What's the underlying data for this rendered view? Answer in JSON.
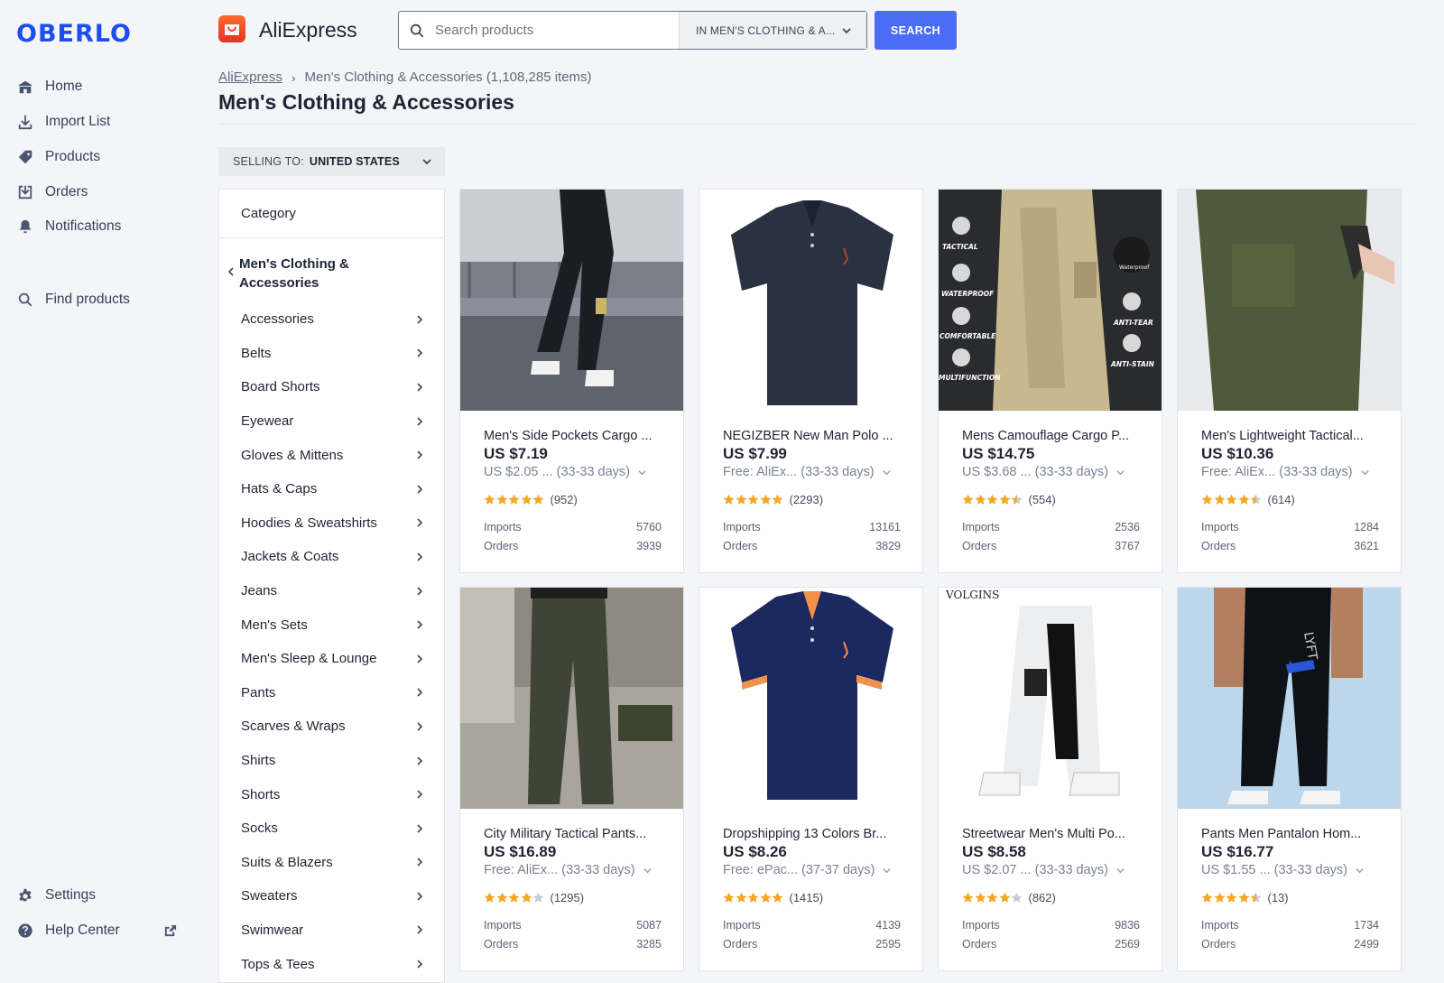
{
  "sidebar": {
    "logo": "OBERLO",
    "nav": [
      {
        "label": "Home",
        "icon": "home-icon"
      },
      {
        "label": "Import List",
        "icon": "import-icon"
      },
      {
        "label": "Products",
        "icon": "tag-icon"
      },
      {
        "label": "Orders",
        "icon": "orders-icon"
      },
      {
        "label": "Notifications",
        "icon": "bell-icon"
      },
      {
        "label": "Find products",
        "icon": "search-icon"
      },
      {
        "label": "Settings",
        "icon": "gear-icon"
      },
      {
        "label": "Help Center",
        "icon": "help-icon"
      }
    ]
  },
  "header": {
    "app_title": "AliExpress",
    "search_placeholder": "Search products",
    "search_scope": "IN MEN'S CLOTHING & A...",
    "search_button": "SEARCH"
  },
  "breadcrumb": {
    "root": "AliExpress",
    "current": "Men's Clothing & Accessories (1,108,285 items)"
  },
  "page_title": "Men's Clothing & Accessories",
  "selling_to": {
    "label": "SELLING TO:",
    "value": "UNITED STATES"
  },
  "category_panel": {
    "header": "Category",
    "parent": "Men's Clothing & Accessories",
    "items": [
      "Accessories",
      "Belts",
      "Board Shorts",
      "Eyewear",
      "Gloves & Mittens",
      "Hats & Caps",
      "Hoodies & Sweatshirts",
      "Jackets & Coats",
      "Jeans",
      "Men's Sets",
      "Men's Sleep & Lounge",
      "Pants",
      "Scarves & Wraps",
      "Shirts",
      "Shorts",
      "Socks",
      "Suits & Blazers",
      "Sweaters",
      "Swimwear",
      "Tops & Tees"
    ]
  },
  "labels": {
    "imports": "Imports",
    "orders": "Orders"
  },
  "colors": {
    "accent": "#4a6cf7",
    "brand": "#1d4ded",
    "star": "#f5a623"
  },
  "products": [
    {
      "title": "Men's Side Pockets Cargo ...",
      "price": "US $7.19",
      "shipping_cost": "US $2.05 ...",
      "shipping_days": "(33-33 days)",
      "rating": 5,
      "reviews": "(952)",
      "imports": "5760",
      "orders": "3939"
    },
    {
      "title": "NEGIZBER New Man Polo ...",
      "price": "US $7.99",
      "shipping_cost": "Free: AliEx...",
      "shipping_days": "(33-33 days)",
      "rating": 5,
      "reviews": "(2293)",
      "imports": "13161",
      "orders": "3829"
    },
    {
      "title": "Mens Camouflage Cargo P...",
      "price": "US $14.75",
      "shipping_cost": "US $3.68 ...",
      "shipping_days": "(33-33 days)",
      "rating": 4.5,
      "reviews": "(554)",
      "imports": "2536",
      "orders": "3767"
    },
    {
      "title": "Men's Lightweight Tactical...",
      "price": "US $10.36",
      "shipping_cost": "Free: AliEx...",
      "shipping_days": "(33-33 days)",
      "rating": 4.5,
      "reviews": "(614)",
      "imports": "1284",
      "orders": "3621"
    },
    {
      "title": "City Military Tactical Pants...",
      "price": "US $16.89",
      "shipping_cost": "Free: AliEx...",
      "shipping_days": "(33-33 days)",
      "rating": 4,
      "reviews": "(1295)",
      "imports": "5087",
      "orders": "3285"
    },
    {
      "title": "Dropshipping 13 Colors Br...",
      "price": "US $8.26",
      "shipping_cost": "Free: ePac...",
      "shipping_days": "(37-37 days)",
      "rating": 5,
      "reviews": "(1415)",
      "imports": "4139",
      "orders": "2595"
    },
    {
      "title": "Streetwear Men's Multi Po...",
      "price": "US $8.58",
      "shipping_cost": "US $2.07 ...",
      "shipping_days": "(33-33 days)",
      "rating": 4,
      "reviews": "(862)",
      "imports": "9836",
      "orders": "2569"
    },
    {
      "title": "Pants Men Pantalon Hom...",
      "price": "US $16.77",
      "shipping_cost": "US $1.55 ...",
      "shipping_days": "(33-33 days)",
      "rating": 4.5,
      "reviews": "(13)",
      "imports": "1734",
      "orders": "2499"
    }
  ],
  "product_images": [
    {
      "icon": "cargo-pants-photo",
      "text": ""
    },
    {
      "icon": "polo-shirt-photo",
      "text": ""
    },
    {
      "icon": "camouflage-cargo-pants-photo",
      "text": "",
      "badges": [
        "TACTICAL",
        "WATERPROOF",
        "COMFORTABLE",
        "MULTIFUNCTION",
        "Waterproof",
        "ANTI-TEAR",
        "ANTI-STAIN"
      ]
    },
    {
      "icon": "tactical-pants-photo",
      "text": ""
    },
    {
      "icon": "military-pants-photo",
      "text": ""
    },
    {
      "icon": "navy-polo-photo",
      "text": ""
    },
    {
      "icon": "streetwear-pants-photo",
      "text": "VOLGINS"
    },
    {
      "icon": "jogger-pants-photo",
      "text": "LYFT"
    }
  ]
}
